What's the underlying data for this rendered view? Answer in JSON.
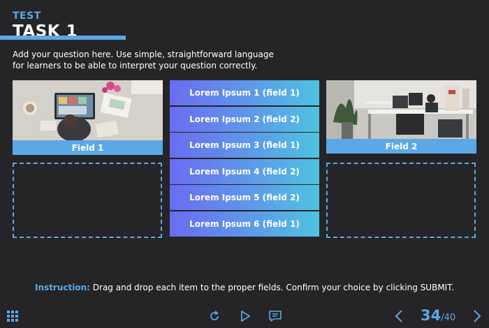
{
  "header": {
    "overline": "TEST",
    "title": "TASK 1"
  },
  "question": {
    "line1": "Add your question here. Use simple, straightforward language",
    "line2": "for learners to be able to interpret your question correctly."
  },
  "fields": [
    {
      "label": "Field 1",
      "image": "office-desk-photo"
    },
    {
      "label": "Field 2",
      "image": "office-workspace-photo"
    }
  ],
  "items": [
    {
      "label": "Lorem Ipsum 1 (field 1)"
    },
    {
      "label": "Lorem Ipsum 2 (field 2)"
    },
    {
      "label": "Lorem Ipsum 3 (field 1)"
    },
    {
      "label": "Lorem Ipsum 4 (field 2)"
    },
    {
      "label": "Lorem Ipsum 5 (field 2)"
    },
    {
      "label": "Lorem Ipsum 6 (field 1)"
    }
  ],
  "instruction": {
    "label": "Instruction:",
    "text": "Drag and drop each item to the proper fields. Confirm your choice by clicking SUBMIT."
  },
  "controls": {
    "menu_icon": "grid-menu-icon",
    "reset_icon": "reset-icon",
    "play_icon": "play-icon",
    "comment_icon": "comment-icon",
    "prev_icon": "chevron-left-icon",
    "next_icon": "chevron-right-icon"
  },
  "pager": {
    "current": "34",
    "total": "/40"
  },
  "colors": {
    "background": "#252527",
    "accent": "#5aa8e6",
    "item_gradient_start": "#6a6cf0",
    "item_gradient_end": "#4fc3e0"
  }
}
